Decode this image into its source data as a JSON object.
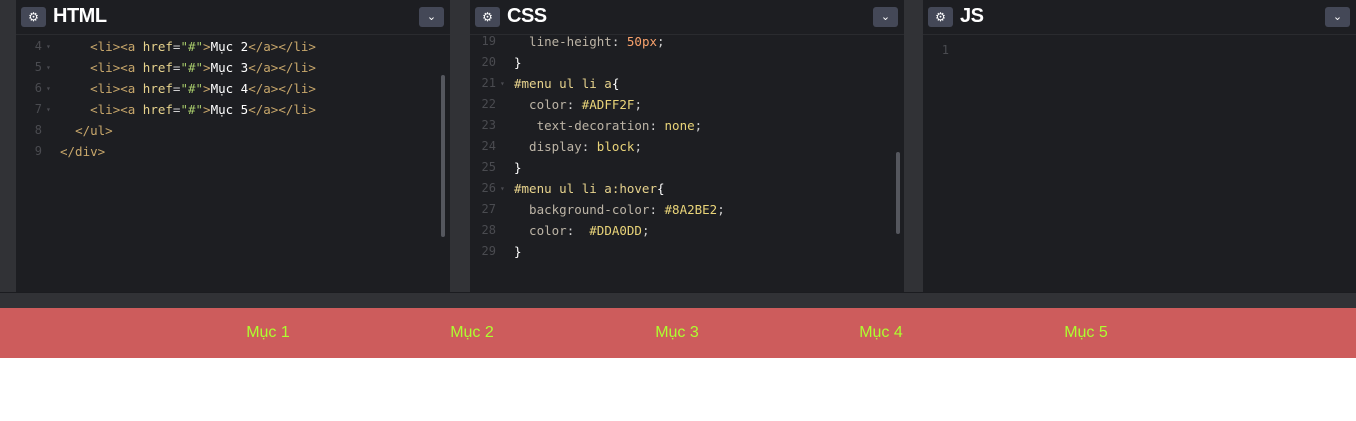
{
  "panes": {
    "html": {
      "title": "HTML",
      "settings_icon": "gear-icon",
      "collapse_icon": "chevron-down-icon"
    },
    "css": {
      "title": "CSS",
      "settings_icon": "gear-icon",
      "collapse_icon": "chevron-down-icon"
    },
    "js": {
      "title": "JS",
      "settings_icon": "gear-icon",
      "collapse_icon": "chevron-down-icon"
    }
  },
  "html_code": [
    {
      "num": "4",
      "fold": "▾",
      "text": "    <li><a href=\"#\">Mục 2</a></li>"
    },
    {
      "num": "5",
      "fold": "▾",
      "text": "    <li><a href=\"#\">Mục 3</a></li>"
    },
    {
      "num": "6",
      "fold": "▾",
      "text": "    <li><a href=\"#\">Mục 4</a></li>"
    },
    {
      "num": "7",
      "fold": "▾",
      "text": "    <li><a href=\"#\">Mục 5</a></li>"
    },
    {
      "num": "8",
      "fold": "",
      "text": "  </ul>"
    },
    {
      "num": "9",
      "fold": "",
      "text": "</div>"
    }
  ],
  "css_code": [
    {
      "num": "19",
      "fold": "",
      "text": "  line-height: 50px;"
    },
    {
      "num": "20",
      "fold": "",
      "text": "}"
    },
    {
      "num": "21",
      "fold": "▾",
      "text": "#menu ul li a{"
    },
    {
      "num": "22",
      "fold": "",
      "text": "  color: #ADFF2F;"
    },
    {
      "num": "23",
      "fold": "",
      "text": "   text-decoration: none;"
    },
    {
      "num": "24",
      "fold": "",
      "text": "  display: block;"
    },
    {
      "num": "25",
      "fold": "",
      "text": "}"
    },
    {
      "num": "26",
      "fold": "▾",
      "text": "#menu ul li a:hover{"
    },
    {
      "num": "27",
      "fold": "",
      "text": "  background-color: #8A2BE2;"
    },
    {
      "num": "28",
      "fold": "",
      "text": "  color:  #DDA0DD;"
    },
    {
      "num": "29",
      "fold": "",
      "text": "}"
    }
  ],
  "js_code": [
    {
      "num": "1",
      "fold": "",
      "text": ""
    }
  ],
  "preview": {
    "menu_bg": "#CD5C5C",
    "link_color": "#ADFF2F",
    "items": [
      "Mục 1",
      "Mục 2",
      "Mục 3",
      "Mục 4",
      "Mục 5"
    ]
  }
}
